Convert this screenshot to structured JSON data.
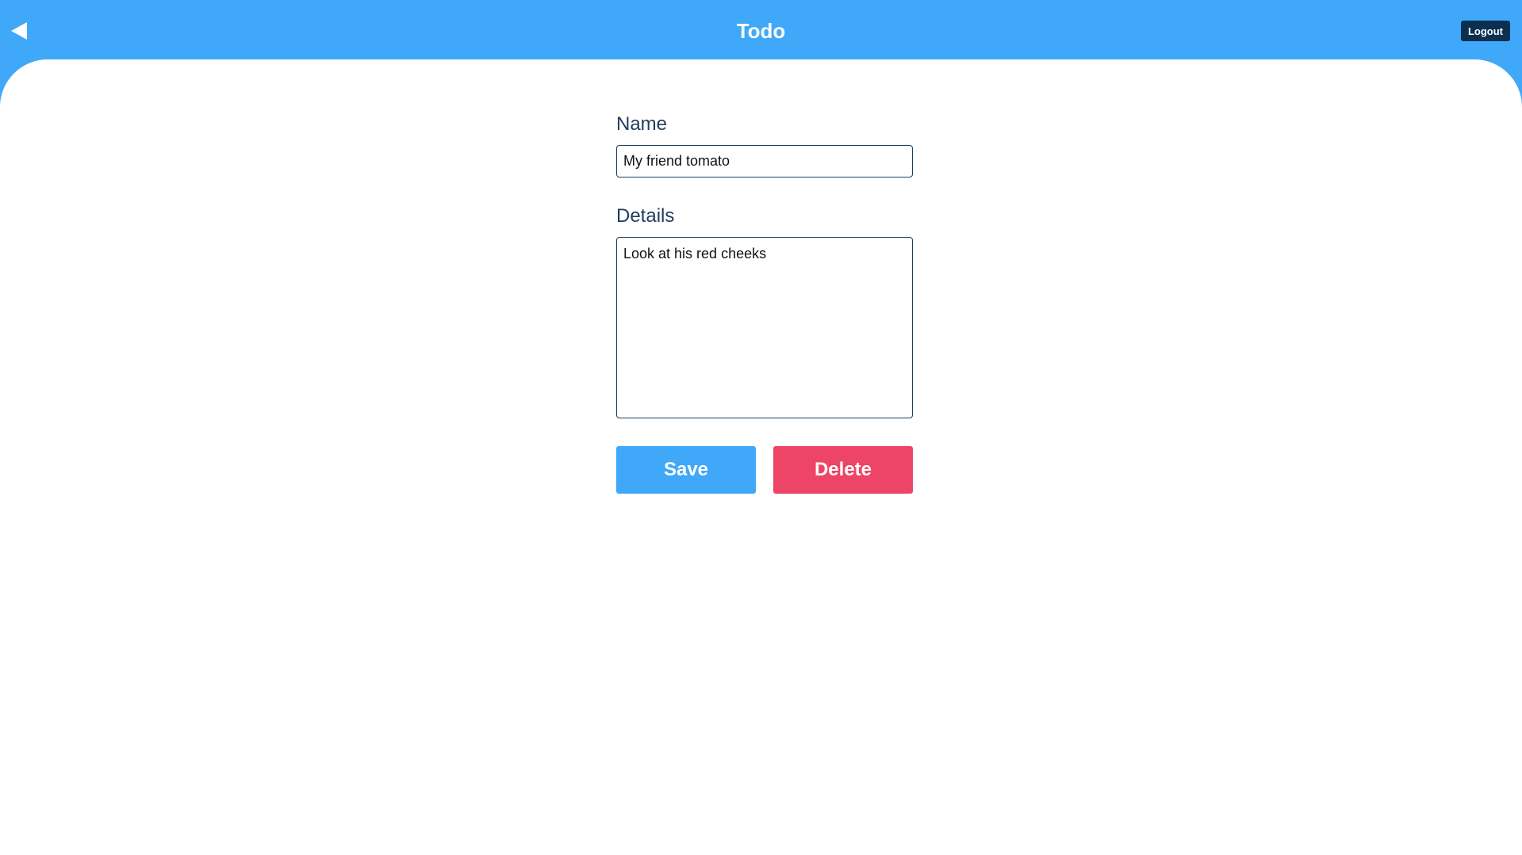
{
  "header": {
    "title": "Todo",
    "back_icon": "back-arrow-icon",
    "logout_label": "Logout",
    "color": "#3fa8f9"
  },
  "form": {
    "name_label": "Name",
    "name_value": "My friend tomato",
    "details_label": "Details",
    "details_value": "Look at his red cheeks",
    "save_label": "Save",
    "delete_label": "Delete",
    "save_color": "#3fa8f9",
    "delete_color": "#ee4466"
  }
}
